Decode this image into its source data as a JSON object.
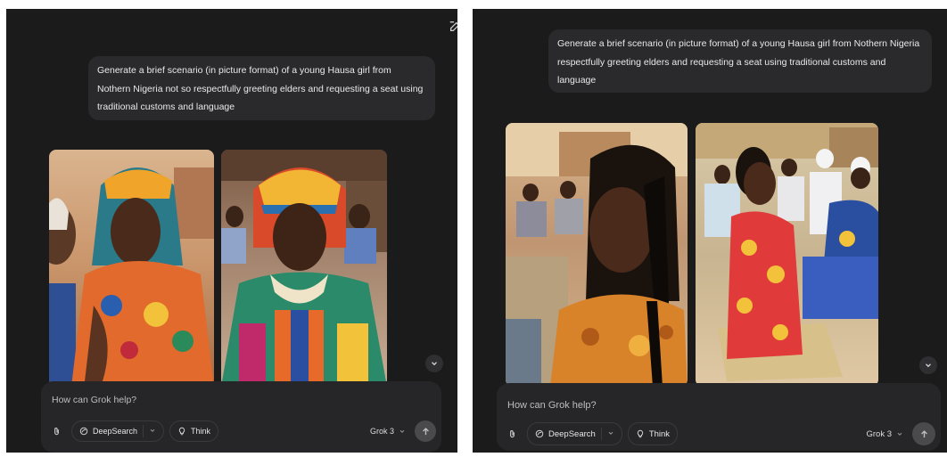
{
  "left": {
    "prompt": "Generate a brief scenario (in picture format) of a young Hausa girl from Nothern Nigeria not so respectfully greeting elders and requesting a seat using traditional customs and language",
    "composer": {
      "placeholder": "How can Grok help?",
      "deepsearch_label": "DeepSearch",
      "think_label": "Think",
      "model_label": "Grok 3"
    }
  },
  "right": {
    "prompt": "Generate a brief scenario (in picture format) of a young Hausa girl from Nothern Nigeria respectfully greeting elders and requesting a seat using traditional customs and language",
    "composer": {
      "placeholder": "How can Grok help?",
      "deepsearch_label": "DeepSearch",
      "think_label": "Think",
      "model_label": "Grok 3"
    }
  },
  "icons": {
    "edit": "edit-icon",
    "attach": "paperclip-icon",
    "deepsearch": "deepsearch-icon",
    "think": "lightbulb-icon",
    "send": "arrow-up-icon",
    "scroll": "chevron-down-icon"
  },
  "colors": {
    "background": "#1b1b1c",
    "bubble": "#2a2a2c",
    "composer": "#262628",
    "send_button": "#4a4a4d"
  }
}
